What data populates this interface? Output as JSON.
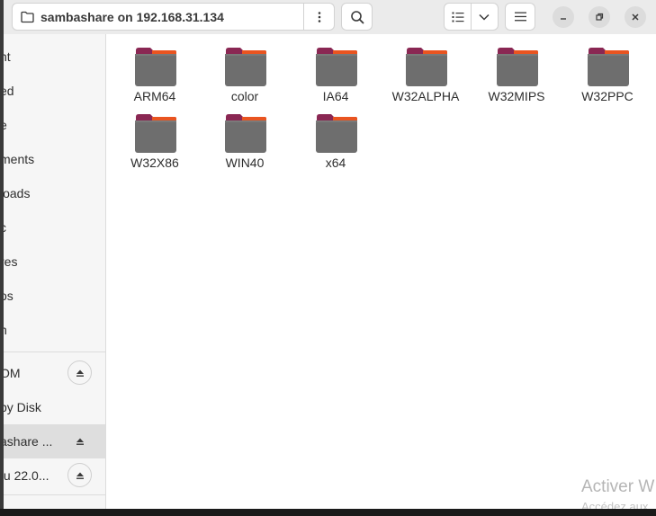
{
  "headerbar": {
    "location_path": "sambashare on 192.168.31.134",
    "location_icon": "folder-icon",
    "location_menu_icon": "vertical-dots-icon",
    "search_icon": "search-icon",
    "view_list_icon": "list-view-icon",
    "view_dropdown_icon": "chevron-down-icon",
    "menu_icon": "hamburger-icon",
    "window_buttons": [
      "minimize-icon",
      "restore-icon",
      "close-icon"
    ]
  },
  "sidebar": {
    "items": [
      {
        "label": "nt"
      },
      {
        "label": "ed"
      },
      {
        "label": "e"
      },
      {
        "label": "ments"
      },
      {
        "label": "loads"
      },
      {
        "label": "c"
      },
      {
        "label": "res"
      },
      {
        "label": "os"
      },
      {
        "label": "n"
      }
    ],
    "devices": [
      {
        "label": "OM",
        "eject": true
      },
      {
        "label": "py Disk",
        "eject": false
      },
      {
        "label": "ashare ...",
        "eject": true,
        "active": true
      },
      {
        "label": "tu 22.0...",
        "eject": true
      }
    ]
  },
  "folders": [
    {
      "name": "ARM64"
    },
    {
      "name": "color"
    },
    {
      "name": "IA64"
    },
    {
      "name": "W32ALPHA"
    },
    {
      "name": "W32MIPS"
    },
    {
      "name": "W32PPC"
    },
    {
      "name": "W32X86"
    },
    {
      "name": "WIN40"
    },
    {
      "name": "x64"
    }
  ],
  "watermark": {
    "line1": "Activer W",
    "line2": "Accédez aux"
  },
  "colors": {
    "folder_body": "#6e6e6e",
    "folder_tab_magenta": "#8a2753",
    "folder_tab_orange": "#e95420"
  }
}
